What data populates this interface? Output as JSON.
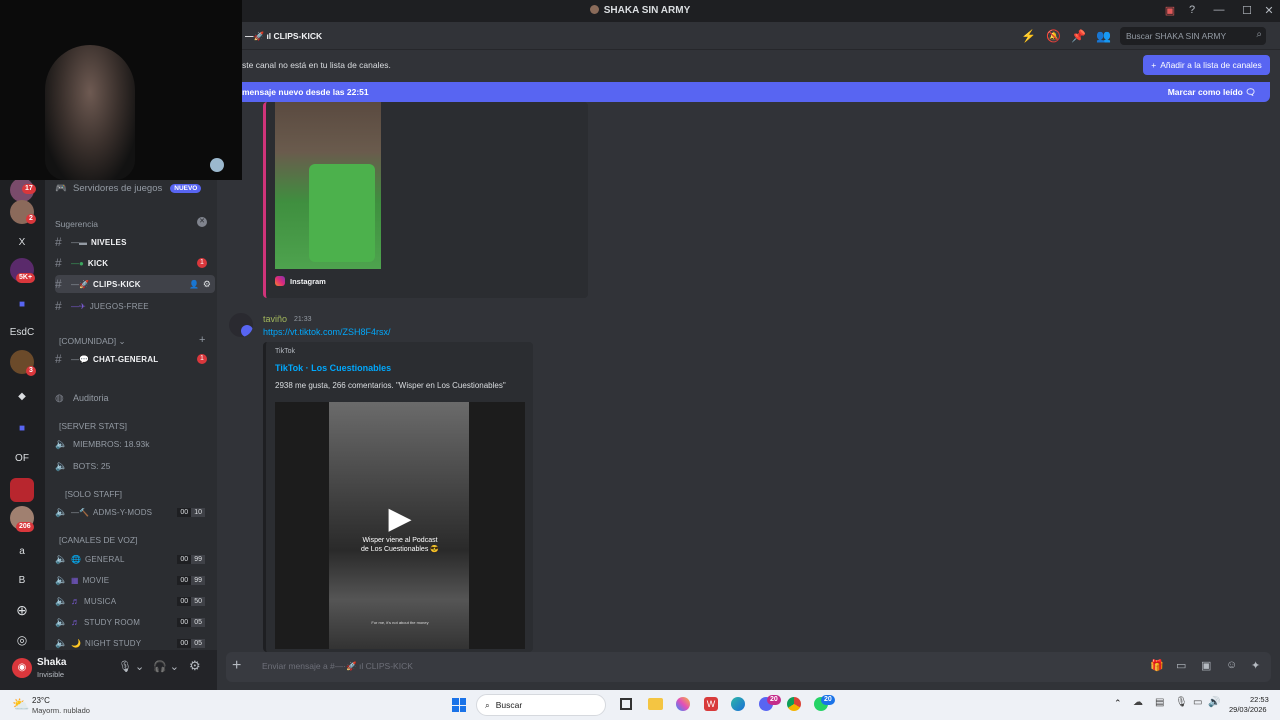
{
  "window": {
    "title": "SHAKA SIN ARMY"
  },
  "servers": [
    {
      "label": "",
      "badge": "17"
    },
    {
      "label": "",
      "badge": "2"
    },
    {
      "label": "X",
      "badge": ""
    },
    {
      "label": "",
      "badge": "5K+"
    },
    {
      "label": "",
      "badge": ""
    },
    {
      "label": "EsdC",
      "badge": ""
    },
    {
      "label": "",
      "badge": "3"
    },
    {
      "label": "",
      "badge": ""
    },
    {
      "label": "",
      "badge": ""
    },
    {
      "label": "OF",
      "badge": ""
    },
    {
      "label": "",
      "badge": ""
    },
    {
      "label": "",
      "badge": "206"
    },
    {
      "label": "a",
      "badge": ""
    },
    {
      "label": "B",
      "badge": ""
    }
  ],
  "sidebar": {
    "game_servers": "Servidores de juegos",
    "game_servers_badge": "NUEVO",
    "suggestion": "Sugerencia",
    "channels": [
      {
        "name": "NIVELES",
        "unread": ""
      },
      {
        "name": "KICK",
        "unread": "1"
      },
      {
        "name": "CLIPS-KICK",
        "unread": ""
      },
      {
        "name": "JUEGOS-FREE",
        "unread": ""
      }
    ],
    "community_category": "[COMUNIDAD]",
    "chat_general": {
      "name": "CHAT-GENERAL",
      "unread": "1"
    },
    "auditoria": "Auditoria",
    "server_stats": "[SERVER STATS]",
    "members": "MIEMBROS: 18.93k",
    "bots": "BOTS: 25",
    "solo_staff": "[SOLO STAFF]",
    "adms": {
      "name": "ADMS-Y-MODS",
      "a": "00",
      "b": "10"
    },
    "voice_category": "[CANALES DE VOZ]",
    "voice": [
      {
        "name": "GENERAL",
        "a": "00",
        "b": "99"
      },
      {
        "name": "MOVIE",
        "a": "00",
        "b": "99"
      },
      {
        "name": "MUSICA",
        "a": "00",
        "b": "50"
      },
      {
        "name": "STUDY ROOM",
        "a": "00",
        "b": "05"
      },
      {
        "name": "NIGHT STUDY",
        "a": "00",
        "b": "05"
      }
    ]
  },
  "user": {
    "name": "Shaka",
    "status": "Invisible"
  },
  "header": {
    "channel": "CLIPS-KICK",
    "search_placeholder": "Buscar SHAKA SIN ARMY"
  },
  "notice": {
    "text": "ste canal no está en tu lista de canales.",
    "add_button": "Añadir a la lista de canales"
  },
  "newbar": {
    "text": "mensaje nuevo desde las 22:51",
    "mark_read": "Marcar como leído"
  },
  "embed1": {
    "provider": "Instagram"
  },
  "message": {
    "author": "taviño",
    "time": "21:33",
    "link": "https://vt.tiktok.com/ZSH8F4rsx/",
    "embed_provider": "TikTok",
    "embed_title": "TikTok · Los Cuestionables",
    "embed_desc": "2938 me gusta, 266 comentarios. \"Wisper en Los Cuestionables\"",
    "video_caption_line1": "Wisper viene al Podcast",
    "video_caption_line2": "de Los Cuestionables 😎",
    "video_subtitle": "For me, it's not about the money"
  },
  "composer": {
    "placeholder": "Enviar mensaje a #—·🚀 ıl CLIPS-KICK"
  },
  "taskbar": {
    "weather_temp": "23°C",
    "weather_desc": "Mayorm. nublado",
    "search": "Buscar",
    "time": "22:53",
    "date": "29/03/2026",
    "discord_badge": "20",
    "wa_badge": "20"
  }
}
